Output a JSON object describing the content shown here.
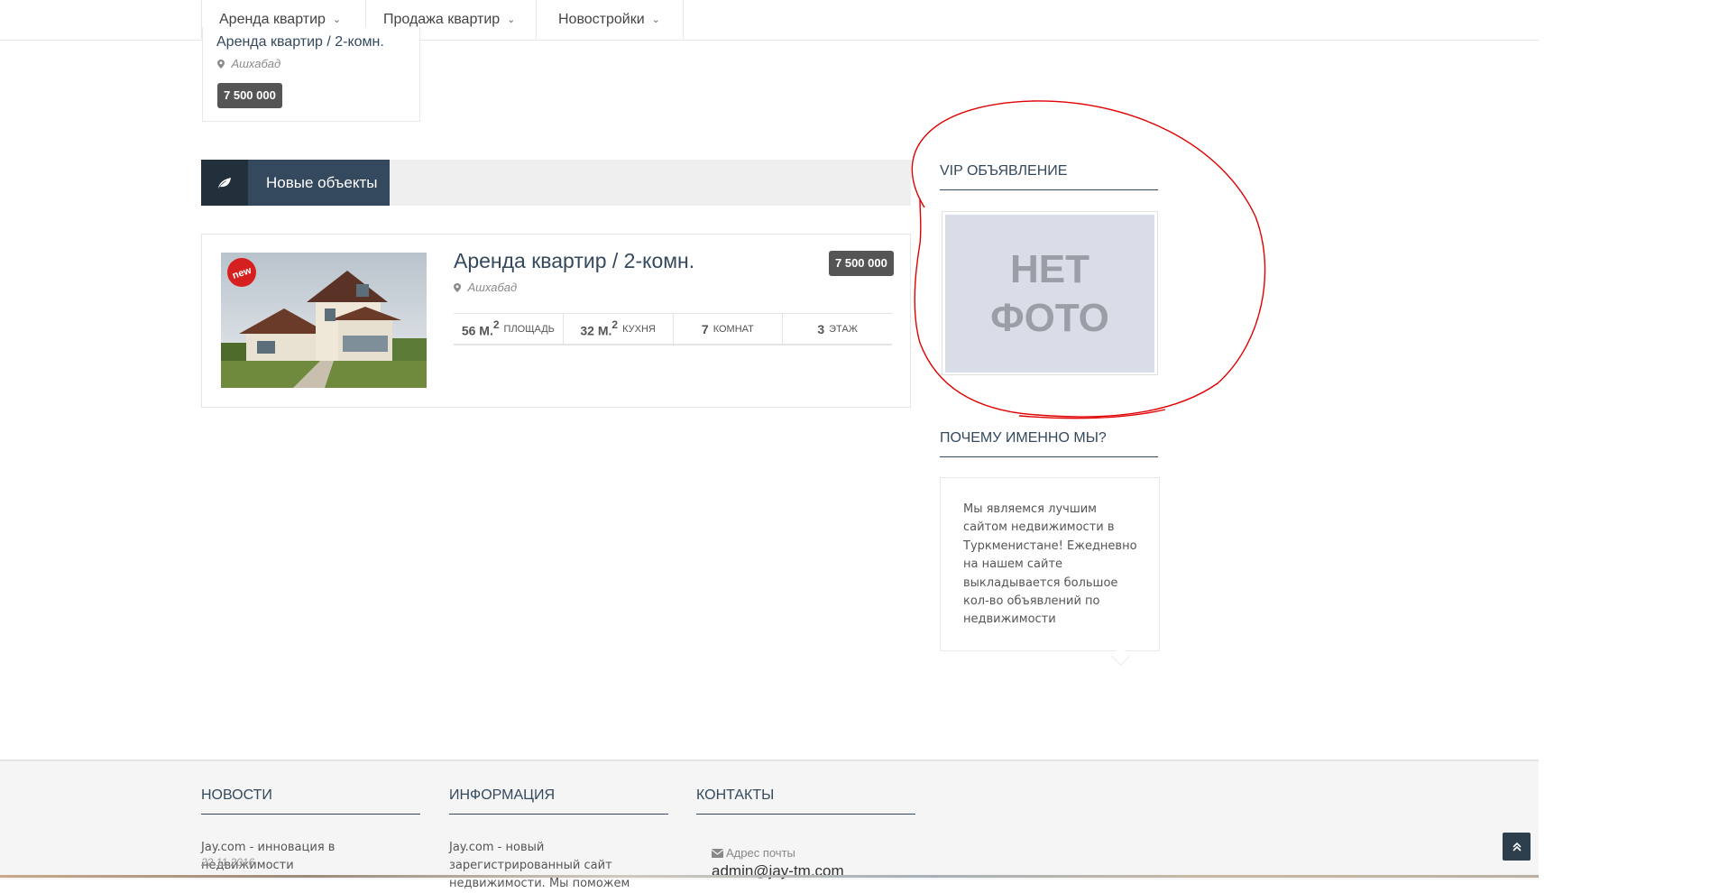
{
  "nav": {
    "items": [
      {
        "label": "Аренда квартир"
      },
      {
        "label": "Продажа квартир"
      },
      {
        "label": "Новостройки"
      }
    ]
  },
  "top_card": {
    "title": "Аренда квартир / 2-комн.",
    "location": "Ашхабад",
    "price": "7 500 000"
  },
  "section": {
    "title": "Новые объекты",
    "icon": "leaf-icon"
  },
  "listing": {
    "badge": "new",
    "title": "Аренда квартир / 2-комн.",
    "location": "Ашхабад",
    "price": "7 500 000",
    "stats": [
      {
        "value": "56 М.",
        "sup": "2",
        "label": "площадь"
      },
      {
        "value": "32 М.",
        "sup": "2",
        "label": "кухня"
      },
      {
        "value": "7",
        "sup": "",
        "label": "комнат"
      },
      {
        "value": "3",
        "sup": "",
        "label": "этаж"
      }
    ]
  },
  "sidebar": {
    "vip_heading": "VIP ОБЪЯВЛЕНИЕ",
    "no_photo_line1": "НЕТ",
    "no_photo_line2": "ФОТО",
    "why_heading": "ПОЧЕМУ ИМЕННО МЫ?",
    "why_text": "Мы являемся лучшим сайтом недвижимости в Туркменистане! Ежедневно на нашем сайте выкладывается большое кол-во объявлений по недвижимости"
  },
  "footer": {
    "news_heading": "НОВОСТИ",
    "news_item": "Jay.com - инновация в недвижимости",
    "news_date": "22.11.2016",
    "info_heading": "ИНФОРМАЦИЯ",
    "info_text": "Jay.com - новый зарегистрированный сайт недвижимости. Мы поможем",
    "contacts_heading": "КОНТАКТЫ",
    "email_label": "Адрес почты",
    "email_value": "admin@jay-tm.com"
  },
  "colors": {
    "accent": "#34495e",
    "accent_dark": "#22303c",
    "annotation": "#e00000",
    "badge": "#555555"
  }
}
